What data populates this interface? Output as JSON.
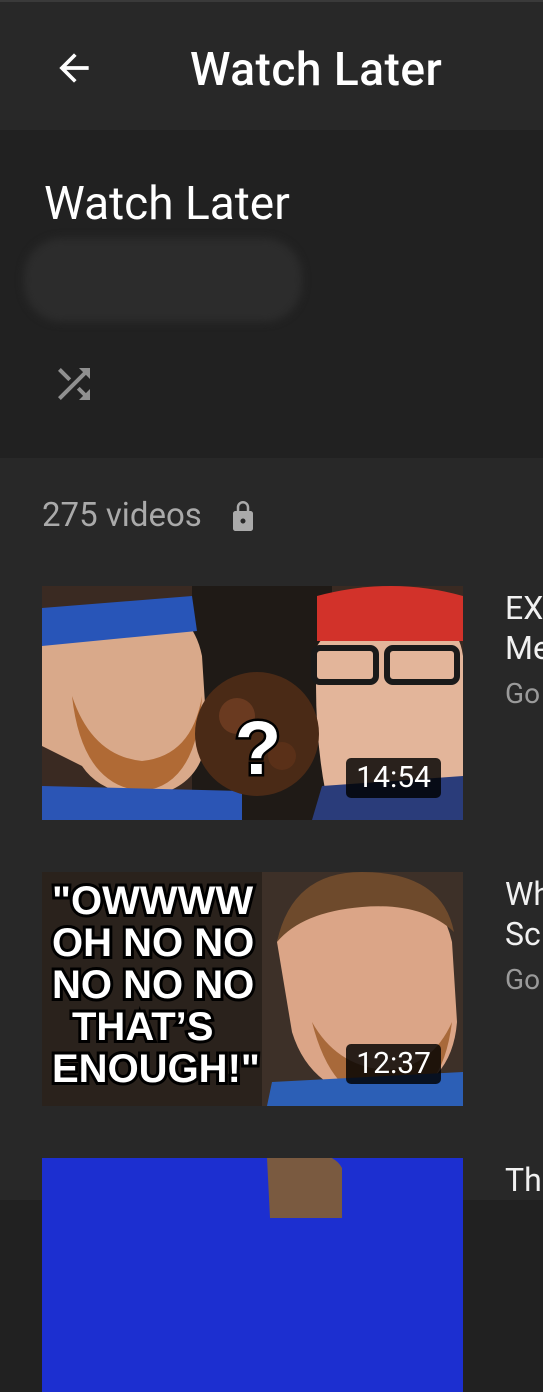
{
  "header": {
    "title": "Watch Later",
    "back_icon": "back-arrow-icon"
  },
  "playlist": {
    "title": "Watch Later",
    "shuffle_icon": "shuffle-icon",
    "video_count": "275 videos",
    "privacy_icon": "lock-icon"
  },
  "videos": [
    {
      "title_line1": "EX",
      "title_line2": "Me",
      "channel": "Go",
      "duration": "14:54",
      "thumb_text": "?"
    },
    {
      "title_line1": "Wh",
      "title_line2": "Sc",
      "channel": "Go",
      "duration": "12:37",
      "thumb_lines": [
        "\"OWWWW",
        "OH NO NO",
        "NO NO NO",
        "THAT’S",
        "ENOUGH!\""
      ]
    },
    {
      "title_line1": "Th",
      "title_line2": "",
      "channel": "",
      "duration": ""
    }
  ],
  "colors": {
    "background": "#212121",
    "list_background": "#282828",
    "secondary_text": "#aaaaaa"
  }
}
